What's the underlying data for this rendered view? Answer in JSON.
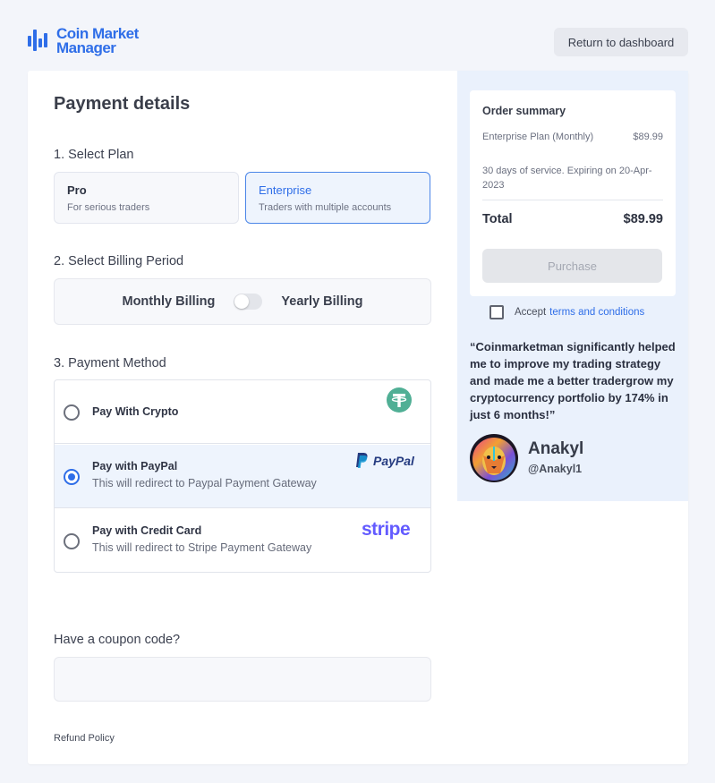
{
  "brand": {
    "name_line1": "Coin Market",
    "name_line2": "Manager",
    "color": "#2f6ee8",
    "icon": "bar-chart-logo-icon"
  },
  "header": {
    "return_label": "Return to dashboard"
  },
  "payment": {
    "title": "Payment details",
    "plan_section": "1. Select Plan",
    "plans": [
      {
        "name": "Pro",
        "desc": "For serious traders",
        "selected": false
      },
      {
        "name": "Enterprise",
        "desc": "Traders with multiple accounts",
        "selected": true
      }
    ],
    "billing_section": "2. Select Billing Period",
    "billing": {
      "left_label": "Monthly Billing",
      "right_label": "Yearly Billing",
      "yearly_on": false
    },
    "method_section": "3. Payment Method",
    "methods": [
      {
        "title": "Pay With Crypto",
        "subtitle": "",
        "selected": false,
        "icon": "tether-icon"
      },
      {
        "title": "Pay with PayPal",
        "subtitle": "This will redirect to Paypal Payment Gateway",
        "selected": true,
        "icon": "paypal-logo",
        "logo_text": "PayPal"
      },
      {
        "title": "Pay with Credit Card",
        "subtitle": "This will redirect to Stripe Payment Gateway",
        "selected": false,
        "icon": "stripe-logo",
        "logo_text": "stripe"
      }
    ],
    "coupon_label": "Have a coupon code?",
    "coupon_value": "",
    "refund_label": "Refund Policy"
  },
  "summary": {
    "title": "Order summary",
    "item": "Enterprise Plan (Monthly)",
    "item_price": "$89.99",
    "note": "30 days of service. Expiring on 20-Apr-2023",
    "total_label": "Total",
    "total_value": "$89.99",
    "purchase_label": "Purchase",
    "accept_prefix": "Accept",
    "terms_label": "terms and conditions",
    "accepted": false
  },
  "testimonial": {
    "quote": "“Coinmarketman significantly helped me to improve my trading strategy and made me a better tradergrow my cryptocurrency portfolio by 174% in just 6 months!”",
    "author": "Anakyl",
    "handle": "@Anakyl1",
    "avatar_icon": "lion-avatar"
  }
}
